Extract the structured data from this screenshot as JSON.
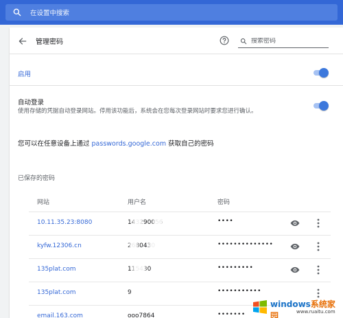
{
  "search": {
    "placeholder": "在设置中搜索"
  },
  "header": {
    "title": "管理密码",
    "password_search_placeholder": "搜索密码"
  },
  "enable": {
    "label": "启用",
    "on": true
  },
  "auto_login": {
    "title": "自动登录",
    "description": "使用存储的凭据自动登录网站。停用该功能后，系统会在您每次登录网站时要求您进行确认。",
    "on": true
  },
  "intro": {
    "before": "您可以在任意设备上通过 ",
    "link": "passwords.google.com",
    "after": " 获取自己的密码"
  },
  "saved": {
    "heading": "已保存的密码",
    "columns": {
      "site": "网站",
      "username": "用户名",
      "password": "密码"
    },
    "rows": [
      {
        "site": "10.11.35.23:8080",
        "username": "143290056",
        "password": "••••"
      },
      {
        "site": "kyfw.12306.cn",
        "username": "2680430",
        "password": "••••••••••••••"
      },
      {
        "site": "135plat.com",
        "username": "115430",
        "password": "•••••••••"
      },
      {
        "site": "135plat.com",
        "username": "9",
        "password": "•••••••••••"
      },
      {
        "site": "email.163.com",
        "username": "ooo7864",
        "password": "•••••••"
      }
    ]
  },
  "watermark": {
    "brand_a": "windows",
    "brand_b": "系统家园",
    "url": "www.ruaitu.com"
  },
  "colors": {
    "accent": "#3367d6",
    "topbar": "#3367d6",
    "toggle_on": "#3c78dc"
  }
}
